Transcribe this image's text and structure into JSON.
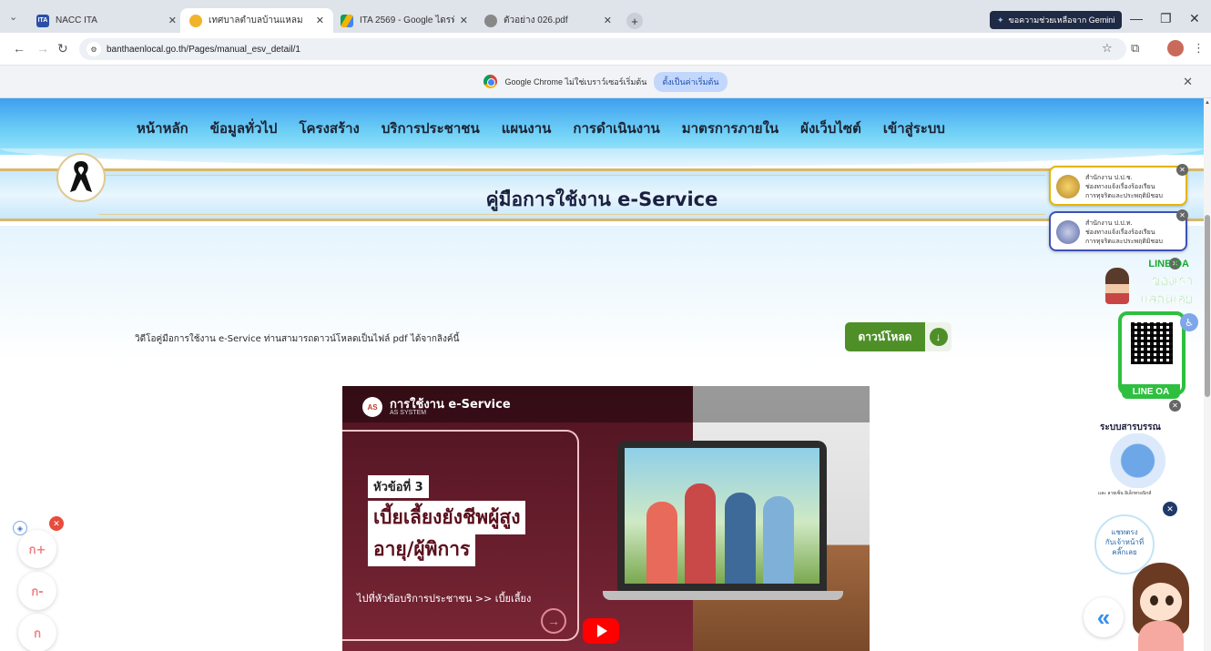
{
  "browser": {
    "tabs": [
      {
        "title": "NACC ITA",
        "favicon_text": "ITA",
        "active": false
      },
      {
        "title": "เทศบาลตำบลบ้านแหลม",
        "favicon_text": "",
        "active": true
      },
      {
        "title": "ITA 2569 - Google ไดรฟ์",
        "favicon_text": "",
        "active": false
      },
      {
        "title": "ตัวอย่าง 026.pdf",
        "favicon_text": "",
        "active": false
      }
    ],
    "gemini_label": "ขอความช่วยเหลือจาก Gemini",
    "url": "banthaenlocal.go.th/Pages/manual_esv_detail/1",
    "infobar_text": "Google Chrome ไม่ใช่เบราว์เซอร์เริ่มต้น",
    "infobar_button": "ตั้งเป็นค่าเริ่มต้น"
  },
  "site": {
    "menu": [
      "หน้าหลัก",
      "ข้อมูลทั่วไป",
      "โครงสร้าง",
      "บริการประชาชน",
      "แผนงาน",
      "การดำเนินงาน",
      "มาตรการภายใน",
      "ผังเว็บไซต์",
      "เข้าสู่ระบบ"
    ],
    "page_title": "คู่มือการใช้งาน e-Service",
    "download_text": "วิดีโอคู่มือการใช้งาน e-Service ท่านสามารถดาวน์โหลดเป็นไฟล์ pdf ได้จากลิงค์นี้",
    "download_button": "ดาวน์โหลด"
  },
  "video": {
    "title": "การใช้งาน e-Service",
    "channel": "AS SYSTEM",
    "logo_text": "AS",
    "topic": "หัวข้อที่ 3",
    "headline1": "เบี้ยเลี้ยงยังชีพผู้สูง",
    "headline2": "อายุ/ผู้พิการ",
    "link_text": "ไปที่หัวข้อบริการประชาชน >> เบี้ยเลี้ยง"
  },
  "widgets": {
    "notice1": [
      "สำนักงาน ป.ป.ช.",
      "ช่องทางแจ้งเรื่องร้องเรียน",
      "การทุจริตและประพฤติมิชอบ"
    ],
    "notice2": [
      "สำนักงาน ป.ป.ท.",
      "ช่องทางแจ้งเรื่องร้องเรียน",
      "การทุจริตและประพฤติมิชอบ"
    ],
    "line_title1": "LINE OA",
    "line_title2": "ของเรา",
    "line_title3": "แสกนเลย",
    "line_label": "LINE OA",
    "saraban_title": "ระบบสารบรรณ",
    "saraban_sub": "และ ลายเซ็น อิเล็กทรอนิกส์",
    "chat_text": [
      "แชทตรง",
      "กับเจ้าหน้าที่",
      "คลิ๊กเลย"
    ],
    "font_buttons": [
      "ก+",
      "ก-",
      "ก"
    ]
  }
}
